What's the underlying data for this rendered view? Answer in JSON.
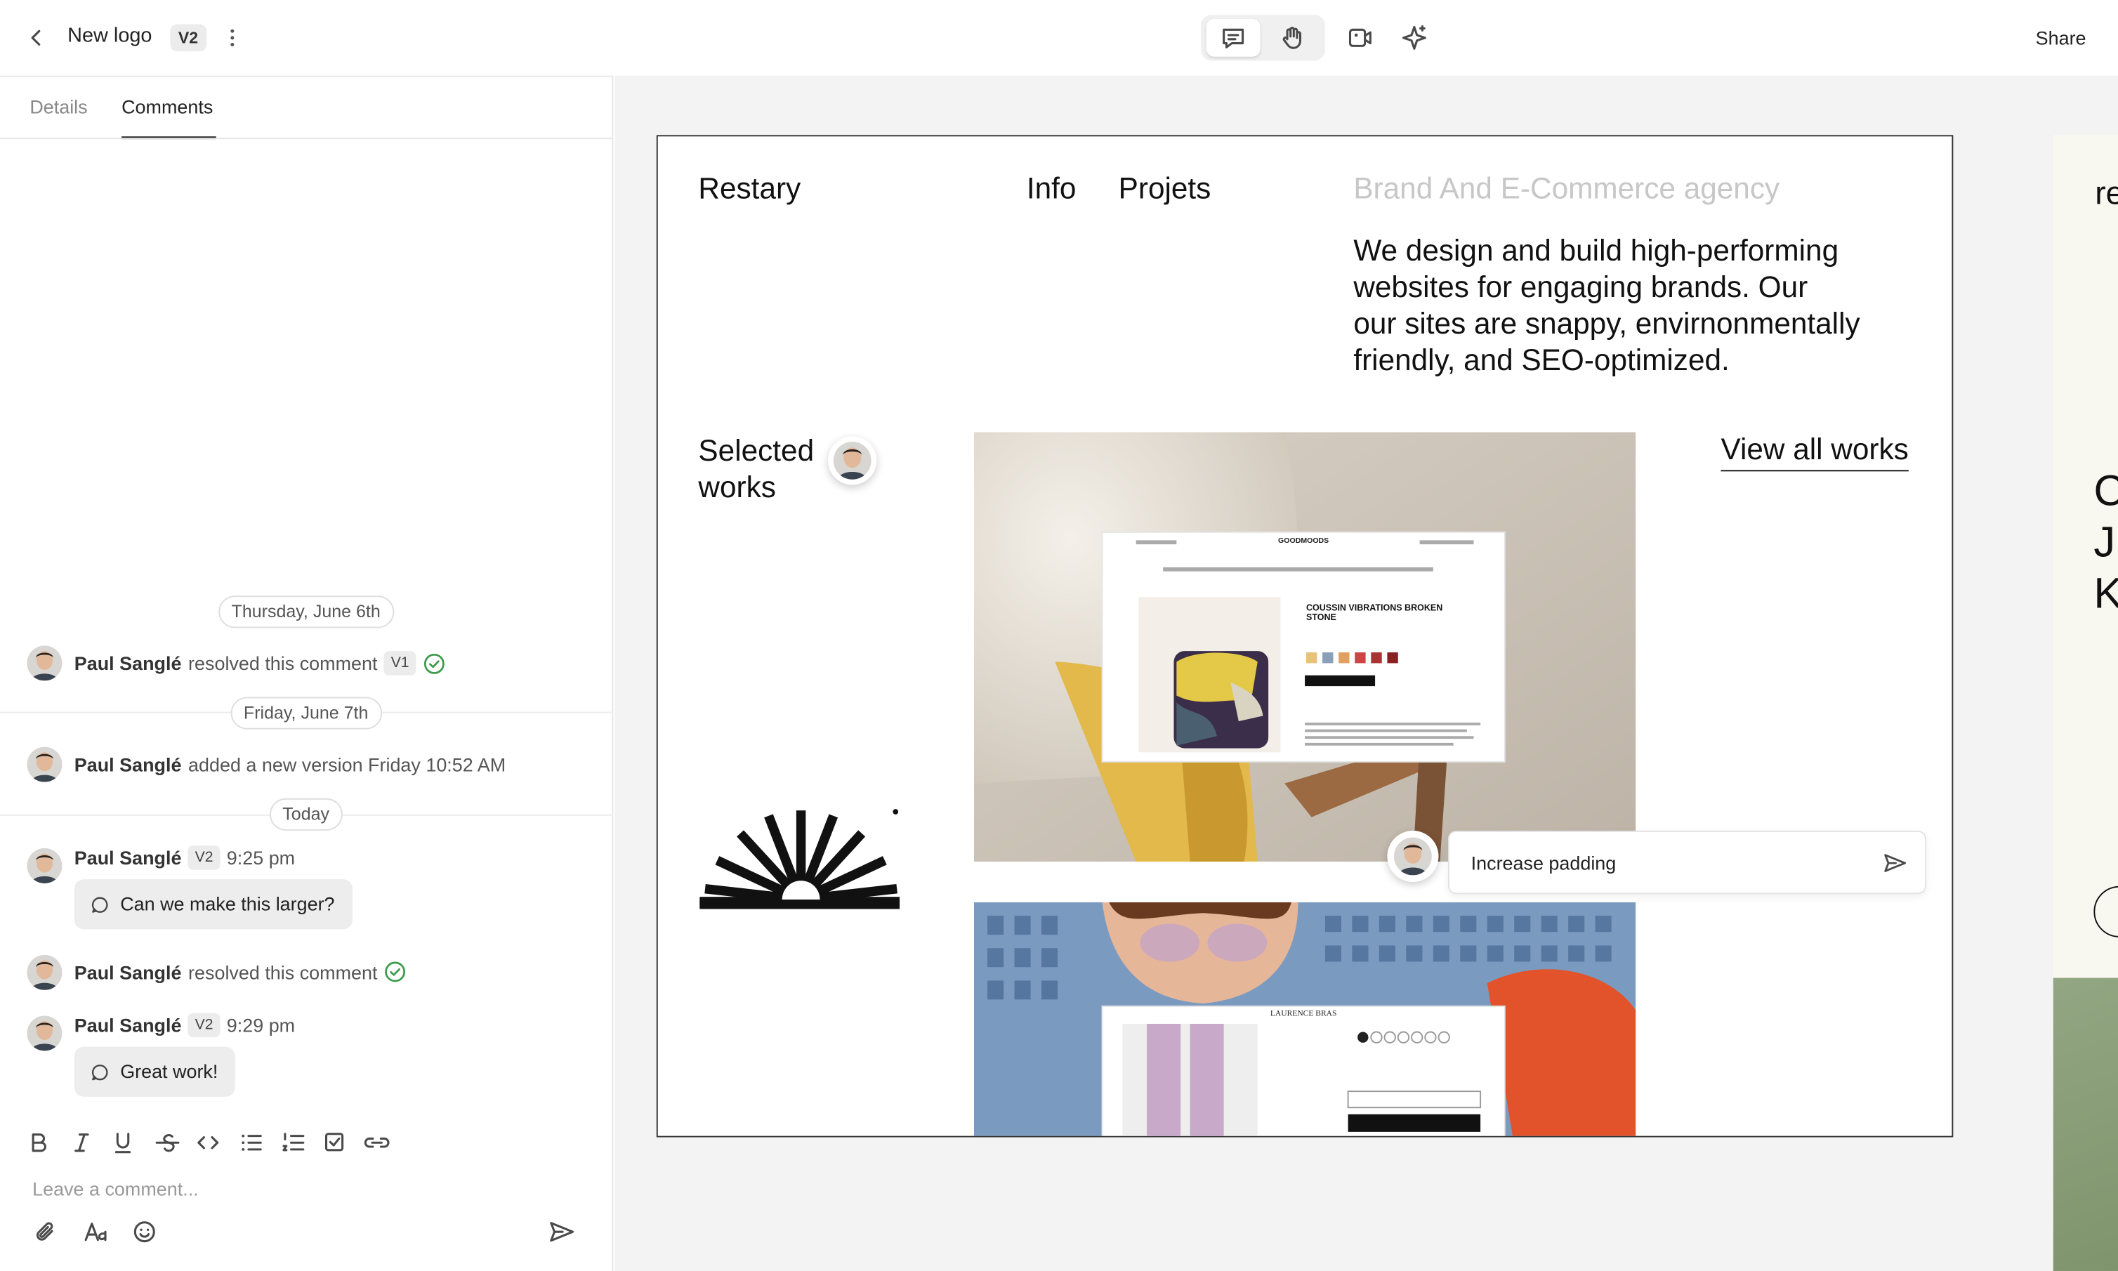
{
  "header": {
    "back_label": "‹",
    "title": "New logo",
    "version": "V2",
    "more_label": "⋮",
    "share_label": "Share"
  },
  "toolbar": {
    "tools": [
      "comment-tool",
      "hand-tool",
      "video-tool",
      "sparkle-tool"
    ],
    "active": "comment-tool"
  },
  "tabs": [
    {
      "label": "Details"
    },
    {
      "label": "Comments",
      "active": true
    }
  ],
  "activity": {
    "dates": [
      "Thursday, June 6th",
      "Friday, June 7th",
      "Today"
    ],
    "events": [
      {
        "author": "Paul Sanglé",
        "text": "resolved this comment",
        "version": "V1"
      },
      {
        "author": "Paul Sanglé",
        "text": "added a new version Friday 10:52 AM"
      },
      {
        "author": "Paul Sanglé",
        "version": "V2",
        "time": "9:25 pm",
        "comment": "Can we make this larger?"
      },
      {
        "author": "Paul Sanglé",
        "text": "resolved this comment"
      },
      {
        "author": "Paul Sanglé",
        "version": "V2",
        "time": "9:29 pm",
        "comment": "Great work!"
      }
    ]
  },
  "editor": {
    "placeholder": "Leave a comment...",
    "format_tools": [
      "bold-icon",
      "italic-icon",
      "underline-icon",
      "strikethrough-icon",
      "code-icon",
      "bullet-list-icon",
      "numbered-list-icon",
      "checklist-icon",
      "link-icon"
    ],
    "bottom_tools": [
      "paperclip-icon",
      "text-format-icon",
      "emoji-icon",
      "send-icon"
    ]
  },
  "design": {
    "brand": "Restary",
    "nav": [
      "Info",
      "Projets"
    ],
    "tagline": "Brand And E-Commerce agency",
    "description": [
      "We design and build high-performing",
      "websites for engaging brands. Our",
      "our sites are snappy, envirnonmentally",
      "friendly, and SEO-optimized."
    ],
    "selected": [
      "Selected",
      "works"
    ],
    "view_all": "View all works",
    "shop1": {
      "logo": "GOODMOODS",
      "product": [
        "COUSSIN VIBRATIONS BROKEN",
        "STONE"
      ]
    },
    "shop2": {
      "logo": "LAURENCE BRAS"
    },
    "right_frame": [
      "re",
      "C",
      "J",
      "K"
    ]
  },
  "pin_comment": {
    "value": "Increase padding"
  },
  "colors": {
    "resolved": "#3a9a4a",
    "canvas": "#f3f3f4",
    "sage": "#8a9e78"
  }
}
